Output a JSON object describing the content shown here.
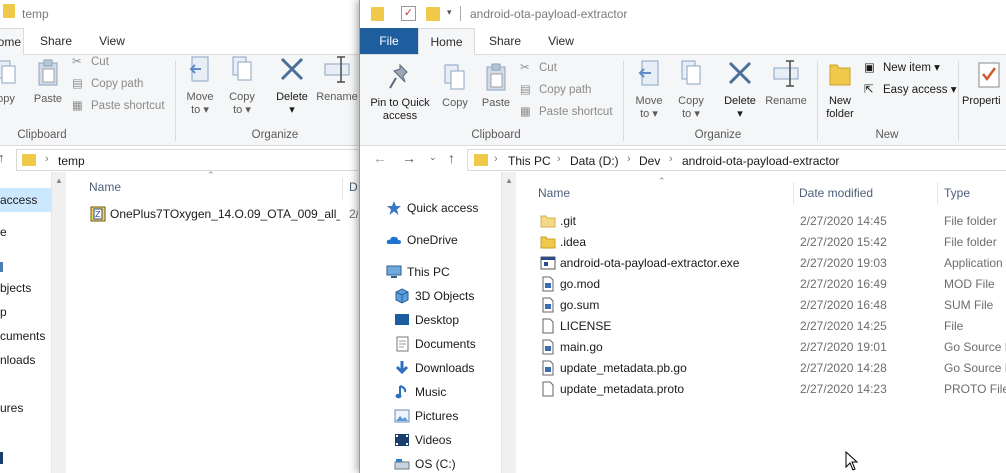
{
  "left_window": {
    "title": "temp",
    "tabs": [
      {
        "label": "ome"
      },
      {
        "label": "Share"
      },
      {
        "label": "View"
      }
    ],
    "ribbon": {
      "copy_partial": "opy",
      "paste": "Paste",
      "cut": "Cut",
      "copy_path": "Copy path",
      "paste_shortcut": "Paste shortcut",
      "clipboard_group": "Clipboard",
      "move_to": "Move",
      "move_to_2": "to",
      "copy_to": "Copy",
      "copy_to_2": "to",
      "delete": "Delete",
      "rename": "Rename",
      "organize_group": "Organize"
    },
    "address": {
      "crumbs": [
        "temp"
      ]
    },
    "nav": [
      {
        "label": "access",
        "selected": true
      },
      {
        "label": "e"
      },
      {
        "label": "bjects"
      },
      {
        "label": "p"
      },
      {
        "label": "cuments"
      },
      {
        "label": "nloads"
      },
      {
        "label": "ures"
      }
    ],
    "columns": {
      "name": "Name",
      "date": "Da"
    },
    "files": [
      {
        "name": "OnePlus7TOxygen_14.O.09_OTA_009_all_1...",
        "date": "2/"
      }
    ]
  },
  "right_window": {
    "title": "android-ota-payload-extractor",
    "tabs": [
      {
        "label": "File"
      },
      {
        "label": "Home"
      },
      {
        "label": "Share"
      },
      {
        "label": "View"
      }
    ],
    "ribbon": {
      "pin_quick_access": "Pin to Quick",
      "pin_quick_access_2": "access",
      "copy": "Copy",
      "paste": "Paste",
      "cut": "Cut",
      "copy_path": "Copy path",
      "paste_shortcut": "Paste shortcut",
      "clipboard_group": "Clipboard",
      "move_to": "Move",
      "move_to_2": "to",
      "copy_to": "Copy",
      "copy_to_2": "to",
      "delete": "Delete",
      "rename": "Rename",
      "organize_group": "Organize",
      "new_folder": "New",
      "new_folder_2": "folder",
      "new_item": "New item",
      "easy_access": "Easy access",
      "new_group": "New",
      "properties": "Properti"
    },
    "address": {
      "crumbs": [
        "This PC",
        "Data (D:)",
        "Dev",
        "android-ota-payload-extractor"
      ]
    },
    "nav": [
      {
        "label": "Quick access"
      },
      {
        "label": "OneDrive"
      },
      {
        "label": "This PC"
      },
      {
        "label": "3D Objects"
      },
      {
        "label": "Desktop"
      },
      {
        "label": "Documents"
      },
      {
        "label": "Downloads"
      },
      {
        "label": "Music"
      },
      {
        "label": "Pictures"
      },
      {
        "label": "Videos"
      },
      {
        "label": "OS (C:)"
      }
    ],
    "columns": {
      "name": "Name",
      "date": "Date modified",
      "type": "Type"
    },
    "files": [
      {
        "name": ".git",
        "date": "2/27/2020 14:45",
        "type": "File folder",
        "kind": "folder"
      },
      {
        "name": ".idea",
        "date": "2/27/2020 15:42",
        "type": "File folder",
        "kind": "folder"
      },
      {
        "name": "android-ota-payload-extractor.exe",
        "date": "2/27/2020 19:03",
        "type": "Application",
        "kind": "exe"
      },
      {
        "name": "go.mod",
        "date": "2/27/2020 16:49",
        "type": "MOD File",
        "kind": "doc"
      },
      {
        "name": "go.sum",
        "date": "2/27/2020 16:48",
        "type": "SUM File",
        "kind": "doc"
      },
      {
        "name": "LICENSE",
        "date": "2/27/2020 14:25",
        "type": "File",
        "kind": "blank"
      },
      {
        "name": "main.go",
        "date": "2/27/2020 19:01",
        "type": "Go Source F",
        "kind": "doc"
      },
      {
        "name": "update_metadata.pb.go",
        "date": "2/27/2020 14:28",
        "type": "Go Source F",
        "kind": "doc"
      },
      {
        "name": "update_metadata.proto",
        "date": "2/27/2020 14:23",
        "type": "PROTO File",
        "kind": "blank"
      }
    ]
  },
  "colors": {
    "file_tab": "#1e5e9e",
    "folder": "#f0c84a",
    "header_text": "#4c607a",
    "selection": "#cce8ff"
  }
}
